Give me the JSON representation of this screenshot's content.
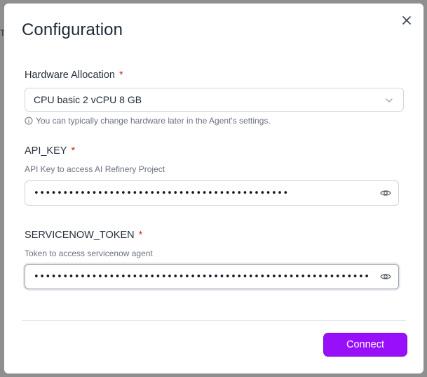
{
  "backdrop": {
    "glyph": "T"
  },
  "dialog": {
    "title": "Configuration",
    "close_icon": "close-icon"
  },
  "hardware": {
    "label": "Hardware Allocation",
    "required_mark": "*",
    "value": "CPU basic 2 vCPU 8 GB",
    "hint": "You can typically change hardware later in the Agent's settings."
  },
  "api_key": {
    "label": "API_KEY",
    "required_mark": "*",
    "description": "API Key to access AI Refinery Project",
    "masked_value": "••••••••••••••••••••••••••••••••••••••••••••"
  },
  "servicenow_token": {
    "label": "SERVICENOW_TOKEN",
    "required_mark": "*",
    "description": "Token to access servicenow agent",
    "masked_value": "••••••••••••••••••••••••••••••••••••••••••••••••••••••••••••"
  },
  "footer": {
    "connect_label": "Connect"
  },
  "colors": {
    "accent": "#9810fa",
    "required": "#dc2626"
  }
}
